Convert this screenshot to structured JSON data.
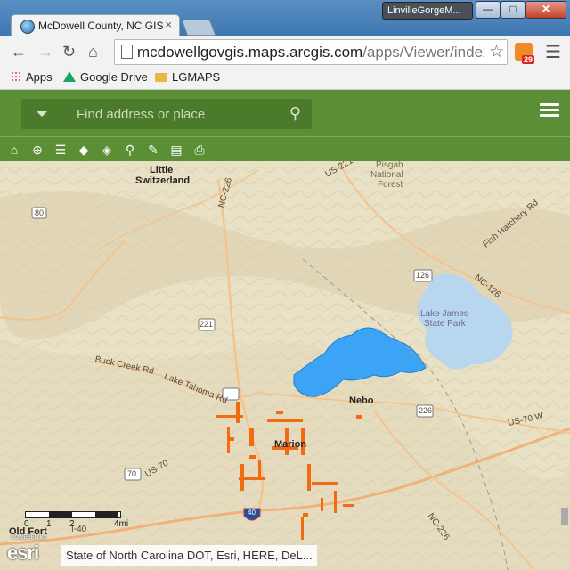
{
  "window": {
    "profile_name": "LinvilleGorgeM...",
    "minimize": "—",
    "maximize": "□",
    "close": "✕"
  },
  "tab": {
    "title": "McDowell County, NC GIS",
    "close": "×"
  },
  "toolbar": {
    "url_host": "mcdowellgovgis.maps.arcgis.com",
    "url_path": "/apps/Viewer/index.ht",
    "rss_badge": "29"
  },
  "bookmarks": [
    {
      "label": "Apps",
      "icon": "apps-grid-icon"
    },
    {
      "label": "Google Drive",
      "icon": "google-drive-icon"
    },
    {
      "label": "LGMAPS",
      "icon": "folder-icon"
    }
  ],
  "app": {
    "search_placeholder": "Find address or place",
    "accent_color": "#5b8f35",
    "tools": [
      "home-icon",
      "locate-icon",
      "list-icon",
      "layers-icon",
      "basemap-icon",
      "measure-icon",
      "draw-icon",
      "comment-icon",
      "print-icon"
    ]
  },
  "map": {
    "labels": {
      "little": "Little",
      "switzerland": "Switzerland",
      "pisgah": "Pisgah",
      "national": "National",
      "forest": "Forest",
      "lake_james": "Lake James",
      "state_park": "State Park",
      "nebo": "Nebo",
      "marion": "Marion",
      "old_fort": "Old Fort",
      "buck_creek_rd": "Buck Creek Rd",
      "lake_tahoma_rd": "Lake Tahoma Rd",
      "fish_hatchery_rd": "Fish Hatchery Rd",
      "nc226a": "NC-226",
      "nc226b": "NC-226",
      "nc126": "NC-126",
      "us70a": "US-70",
      "us70b": "US-70 W",
      "us221": "US-221",
      "i40": "I-40",
      "route_80": "80",
      "route_221": "221",
      "route_126": "126",
      "route_70": "70",
      "route_40": "40",
      "route_226": "226"
    },
    "scale_labels": [
      "0",
      "1",
      "2",
      "4mi"
    ],
    "powered_by": "POWERED BY",
    "esri_logo": "esri",
    "attribution": "State of North Carolina DOT, Esri, HERE, DeL..."
  }
}
